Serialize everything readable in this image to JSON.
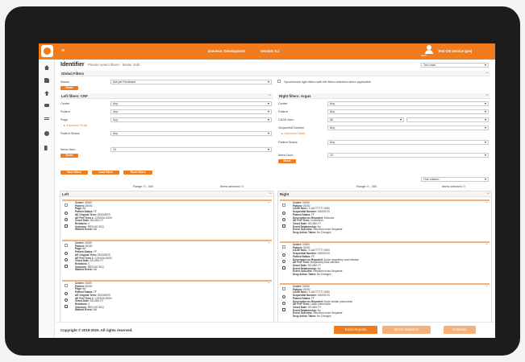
{
  "topbar": {
    "menu_icon": "hamburger-icon",
    "environment": "Instance: Development",
    "version": "Version: 0.1",
    "user_tag": "NEW",
    "user_name": "Test CM Service (pm)"
  },
  "sidebar": {
    "items": [
      {
        "icon": "home-icon"
      },
      {
        "icon": "document-icon"
      },
      {
        "icon": "upload-icon"
      },
      {
        "icon": "monitor-icon"
      },
      {
        "icon": "list-icon"
      },
      {
        "icon": "help-icon"
      },
      {
        "icon": "logout-icon"
      }
    ]
  },
  "page": {
    "title": "Identifier",
    "subtitle": "Please select filters - Mode: Edit",
    "view_select": "Two rows"
  },
  "global_filters": {
    "title": "Global Filters",
    "status_label": "Status",
    "status_value": "Not yet Reviewed",
    "sync_label": "Synchronize right filters with left filters selection when applicable",
    "reset": "Reset"
  },
  "left_filters": {
    "title": "Left filters: CRF",
    "center_label": "Center",
    "center_value": "Any",
    "patient_label": "Patient",
    "patient_value": "Any",
    "page_label": "Page",
    "page_value": "Any",
    "important_fields": "Important Fields",
    "patient_status_label": "Patient Status",
    "patient_status_value": "Any",
    "items_num_label": "Items Num.",
    "items_num_value": "10",
    "reset": "Reset"
  },
  "right_filters": {
    "title": "Right filters: Argus",
    "center_label": "Center",
    "center_value": "Any",
    "patient_label": "Patient",
    "patient_value": "Any",
    "case_num_label": "CASE Num.",
    "case_num_value": "All",
    "seq_num_label": "Sequential Number",
    "seq_num_value": "Any",
    "important_fields": "Important Fields",
    "patient_status_label": "Patient Status",
    "patient_status_value": "Any",
    "items_num_label": "Items Num.",
    "items_num_value": "10",
    "reset": "Reset"
  },
  "actions": {
    "save": "Save filters",
    "load": "Load filters",
    "reset": "Reset filters",
    "column_select": "One column"
  },
  "left": {
    "range": "Range: 0 - 300",
    "selected": "Items selected: 0",
    "title": "Left",
    "cards": [
      {
        "lines": [
          [
            "Center:",
            "00000"
          ],
          [
            "Patient:",
            "00000"
          ],
          [
            "Page:",
            "AE"
          ],
          [
            "Patient Status:",
            "FF"
          ],
          [
            "AE Original Term:",
            "SEIZURES"
          ],
          [
            "AE Pref Term 1:",
            "CONVULSION"
          ],
          [
            "Onset Date:",
            "DD-MM-YY"
          ],
          [
            "Relations:",
            "0"
          ],
          [
            "Outcome:",
            "RES-NO SEQ"
          ],
          [
            "Waived Event:",
            "NA"
          ]
        ]
      },
      {
        "lines": [
          [
            "Center:",
            "00000"
          ],
          [
            "Patient:",
            "00000"
          ],
          [
            "Page:",
            "AE"
          ],
          [
            "Patient Status:",
            "FF"
          ],
          [
            "AE Original Term:",
            "SEIZURES"
          ],
          [
            "AE Pref Term 1:",
            "CONVULSION"
          ],
          [
            "Onset Date:",
            "DD-MM-YY"
          ],
          [
            "Relations:",
            "0"
          ],
          [
            "Outcome:",
            "RES-NO SEQ"
          ],
          [
            "Waived Event:",
            "NA"
          ]
        ]
      },
      {
        "lines": [
          [
            "Center:",
            "00000"
          ],
          [
            "Patient:",
            "00000"
          ],
          [
            "Page:",
            "AE"
          ],
          [
            "Patient Status:",
            "FF"
          ],
          [
            "AE Original Term:",
            "SEIZURES"
          ],
          [
            "AE Pref Term 1:",
            "CONVULSION"
          ],
          [
            "Onset Date:",
            "DD-MM-YY"
          ],
          [
            "Relations:",
            "0"
          ],
          [
            "Outcome:",
            "RES-NO SEQ"
          ],
          [
            "Waived Event:",
            "NA"
          ]
        ]
      }
    ]
  },
  "right": {
    "range": "Range: 0 - 300",
    "selected": "Items selected: 0",
    "title": "Right",
    "cards": [
      {
        "lines": [
          [
            "Center:",
            "00000"
          ],
          [
            "Patient:",
            "00000"
          ],
          [
            "CASE Num.:",
            "X-AA777777-0000"
          ],
          [
            "Sequential Number:",
            "000000 00"
          ],
          [
            "Patient Status:",
            "FF"
          ],
          [
            "Description as Reported:",
            "Seizures"
          ],
          [
            "AE Pref Term:",
            "Convulsion"
          ],
          [
            "Onset Date:",
            "DD-MM-YY"
          ],
          [
            "Event Relationship:",
            "No"
          ],
          [
            "Event Outcome:",
            "Resolved w/out Sequelae"
          ],
          [
            "Drug Action Taken:",
            "No Changes"
          ]
        ]
      },
      {
        "lines": [
          [
            "Center:",
            "00000"
          ],
          [
            "Patient:",
            "00000"
          ],
          [
            "CASE Num.:",
            "X-AA777777-0000"
          ],
          [
            "Sequential Number:",
            "000000 00"
          ],
          [
            "Patient Status:",
            "FF"
          ],
          [
            "Description as Reported:",
            "Acute respiratory viral infection"
          ],
          [
            "AE Pref Term:",
            "Respiratory tract infection"
          ],
          [
            "Onset Date:",
            "DD-MM-YY"
          ],
          [
            "Event Relationship:",
            "No"
          ],
          [
            "Event Outcome:",
            "Resolved w/out Sequelae"
          ],
          [
            "Drug Action Taken:",
            "No Changes"
          ]
        ]
      },
      {
        "lines": [
          [
            "Center:",
            "00000"
          ],
          [
            "Patient:",
            "00000"
          ],
          [
            "CASE Num.:",
            "X-AA777777-0000"
          ],
          [
            "Sequential Number:",
            "000000 00"
          ],
          [
            "Patient Status:",
            "FF"
          ],
          [
            "Description as Reported:",
            "Acute lobular pneumonia"
          ],
          [
            "AE Pref Term:",
            "Lobar pneumonia"
          ],
          [
            "Onset Date:",
            "DD-MM-YY"
          ],
          [
            "Event Relationship:",
            "No"
          ],
          [
            "Event Outcome:",
            "Resolved w/out Sequelae"
          ],
          [
            "Drug Action Taken:",
            "No Changes"
          ]
        ]
      }
    ]
  },
  "footer": {
    "copyright": "Copyright © 2019-2020. All rights reserved.",
    "excel": "Excel Reports",
    "reset_selection": "Reset Selection",
    "continue": "Continue"
  },
  "colors": {
    "accent": "#f07c1d",
    "accent_light": "#f6b27c"
  }
}
